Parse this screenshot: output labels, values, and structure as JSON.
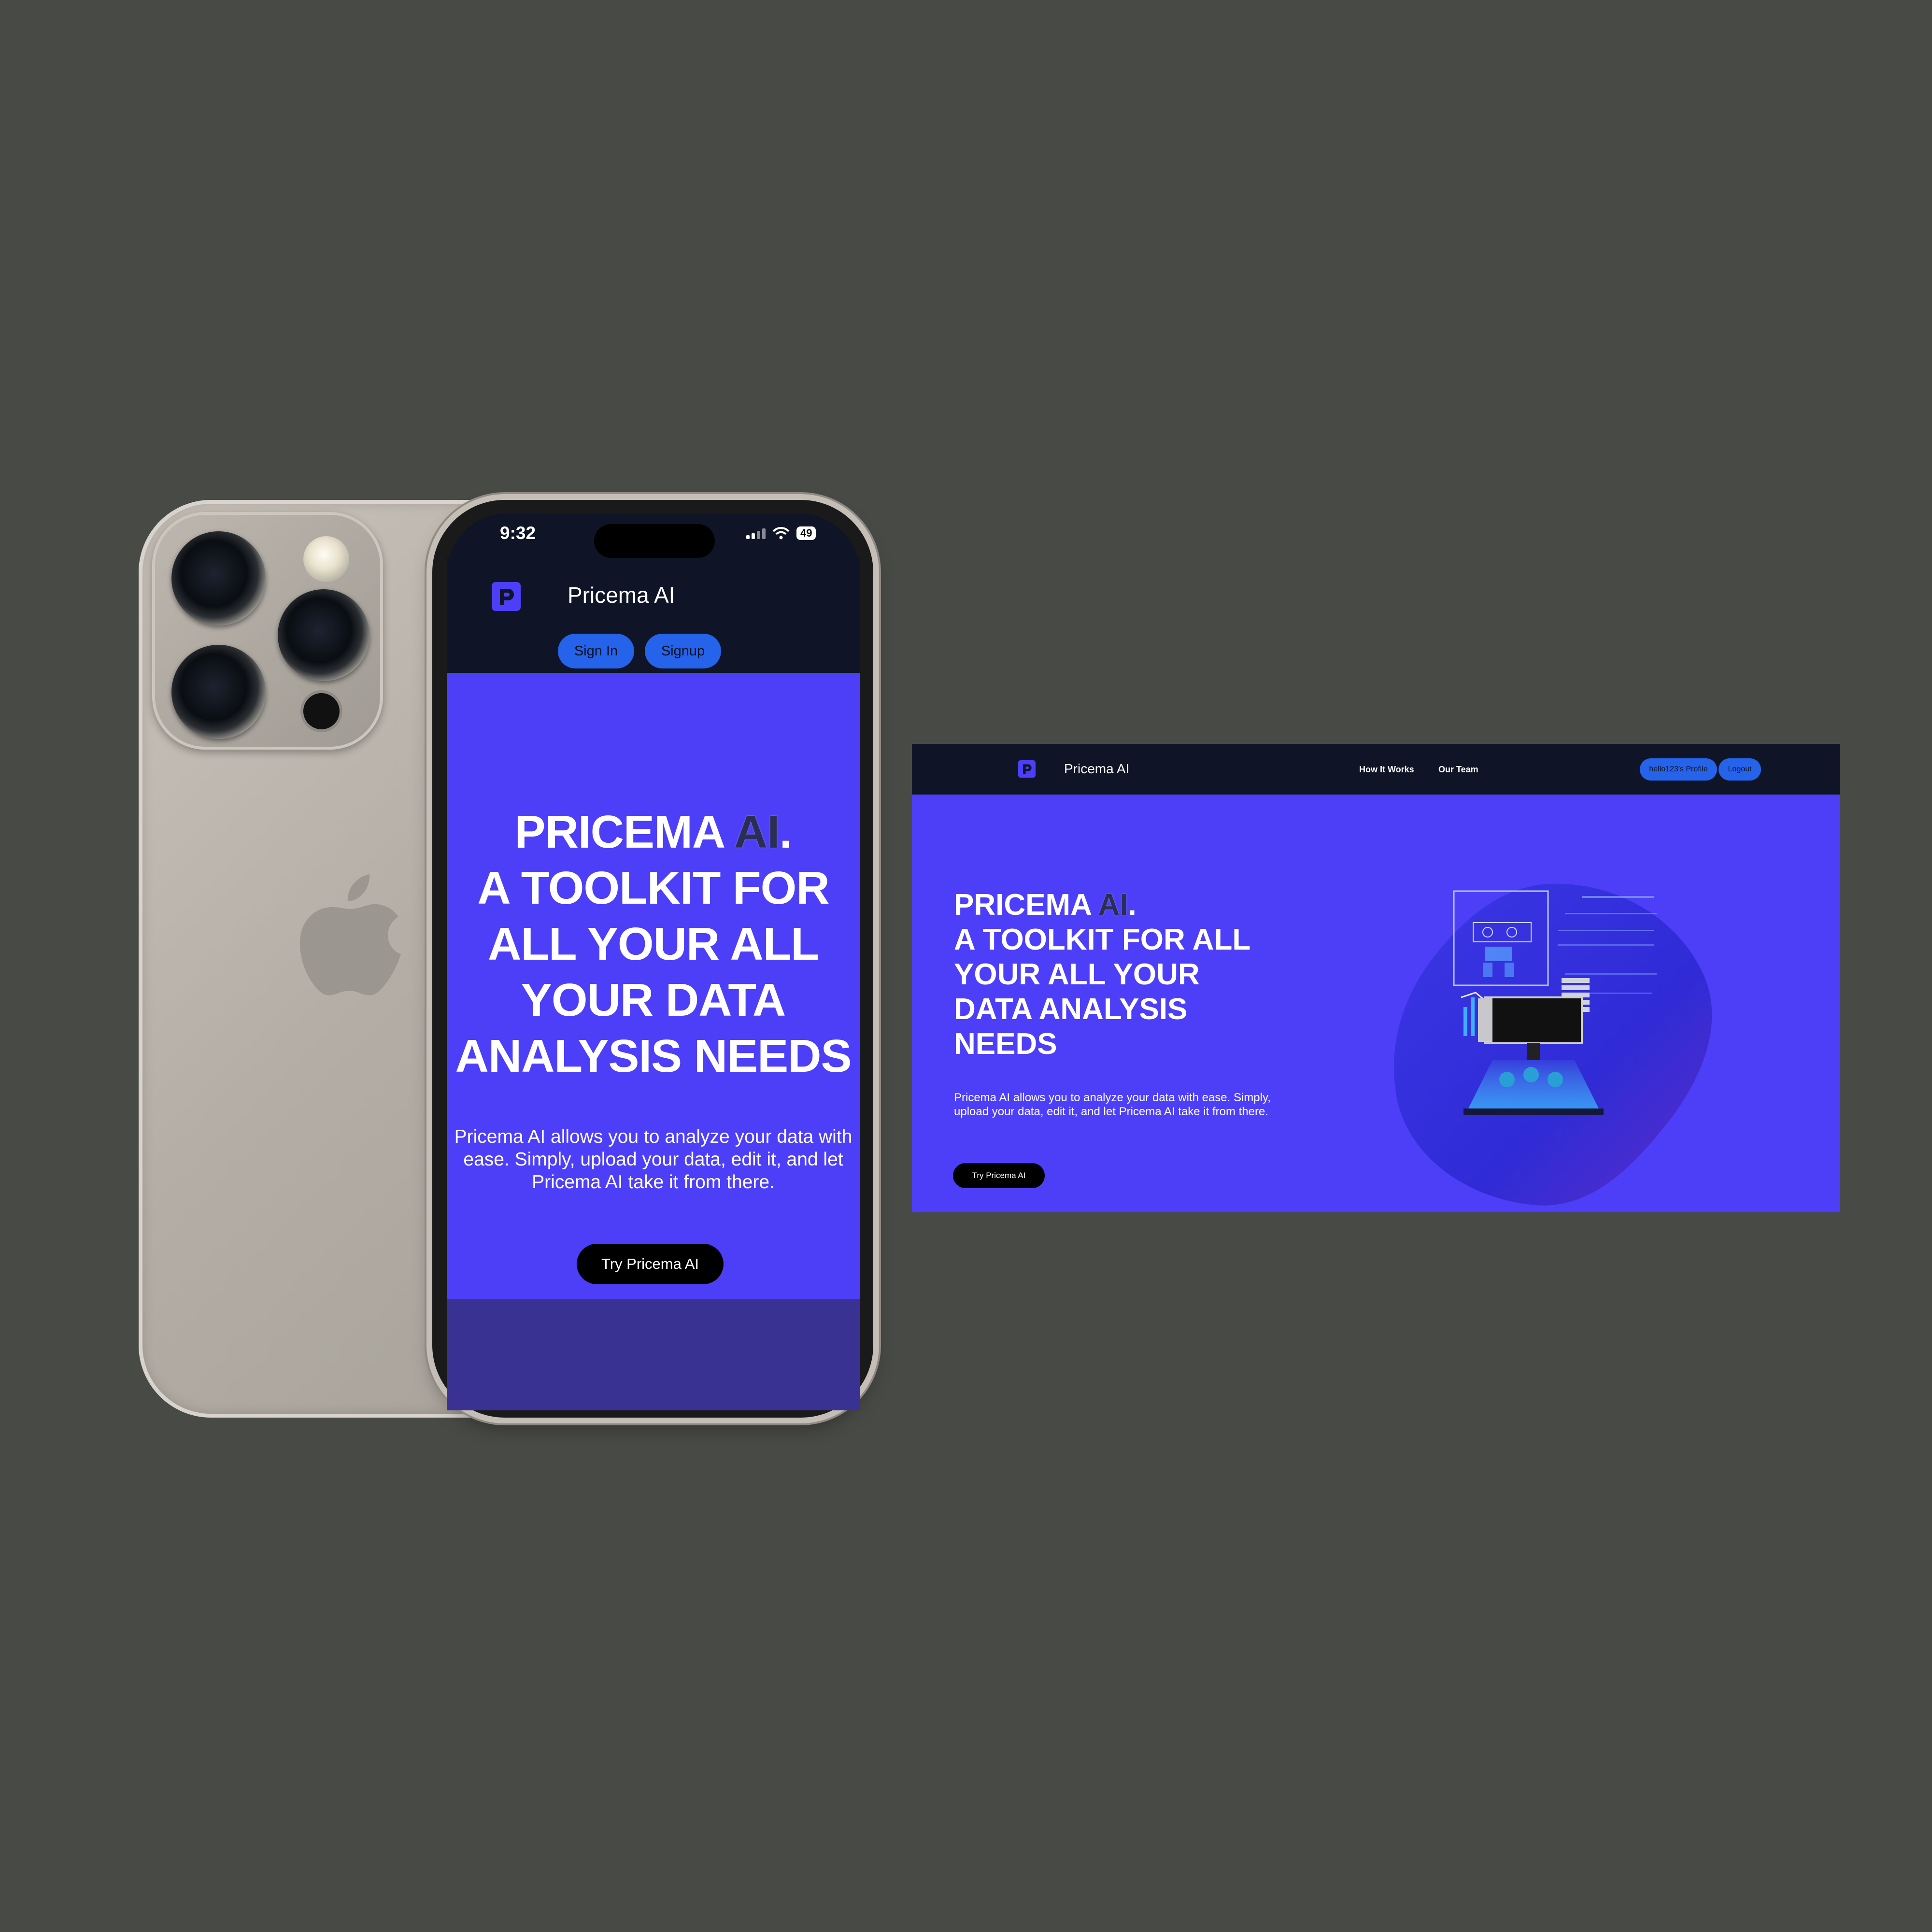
{
  "phone": {
    "status": {
      "time": "9:32",
      "battery": "49"
    },
    "nav": {
      "brand": "Pricema AI",
      "signin_label": "Sign In",
      "signup_label": "Signup"
    },
    "hero": {
      "title_brand": "PRICEMA ",
      "title_ai": "AI",
      "title_dot": ".",
      "title_lines": [
        "A TOOLKIT FOR",
        "ALL YOUR ALL",
        "YOUR DATA",
        "ANALYSIS NEEDS"
      ],
      "description": "Pricema AI allows you to analyze your data with ease. Simply, upload your data, edit it, and let Pricema AI take it from there.",
      "cta_label": "Try Pricema AI"
    }
  },
  "desktop": {
    "nav": {
      "brand": "Pricema AI",
      "links": [
        "How It Works",
        "Our Team"
      ],
      "profile_label": "hello123's Profile",
      "logout_label": "Logout"
    },
    "hero": {
      "title_brand": "PRICEMA ",
      "title_ai": "AI",
      "title_dot": ".",
      "title_lines": [
        "A TOOLKIT FOR ALL",
        "YOUR ALL YOUR",
        "DATA ANALYSIS",
        "NEEDS"
      ],
      "description": "Pricema AI allows you to analyze your data with ease. Simply, upload your data, edit it, and let Pricema AI take it from there.",
      "cta_label": "Try Pricema AI"
    }
  },
  "colors": {
    "background": "#484a46",
    "nav_dark": "#0f1526",
    "hero_purple": "#4d3ff7",
    "button_blue": "#2563eb",
    "cta_black": "#000000"
  },
  "icons": [
    "pricema-logo-icon",
    "apple-logo-icon",
    "signal-icon",
    "wifi-icon",
    "battery-icon",
    "data-analysis-illustration"
  ]
}
